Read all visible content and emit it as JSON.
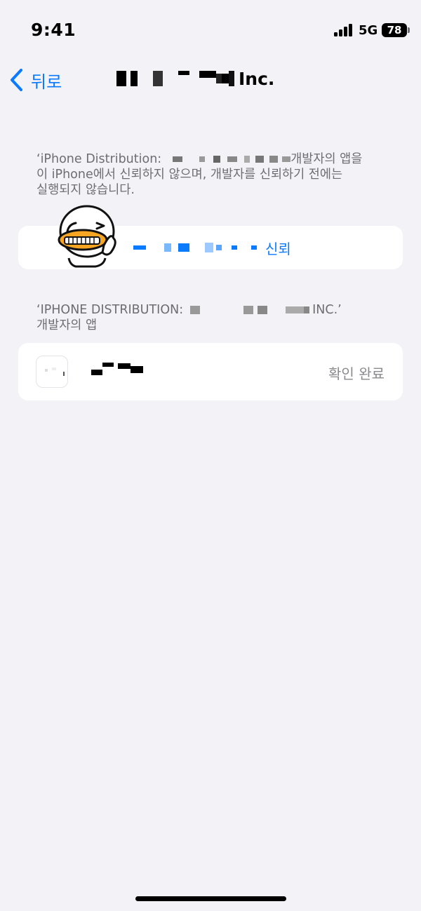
{
  "status_bar": {
    "time": "9:41",
    "network": "5G",
    "battery": "78"
  },
  "nav": {
    "back_label": "뒤로",
    "title_suffix": "Inc."
  },
  "trust_section": {
    "description_line1": "‘iPhone Distribution:",
    "description_line1_tail": "개발자의 앱을",
    "description_line2": "이 iPhone에서 신뢰하지 않으며, 개발자를 신뢰하기 전에는",
    "description_line3": "실행되지 않습니다.",
    "trust_label": "신뢰"
  },
  "apps_section": {
    "header_prefix": "‘IPHONE DISTRIBUTION:",
    "header_suffix": "INC.’",
    "header_line2": "개발자의 앱",
    "apps": [
      {
        "status": "확인 완료"
      }
    ]
  },
  "colors": {
    "accent": "#0a7aff",
    "background": "#f2f2f7",
    "secondary_text": "#6d6d72"
  }
}
